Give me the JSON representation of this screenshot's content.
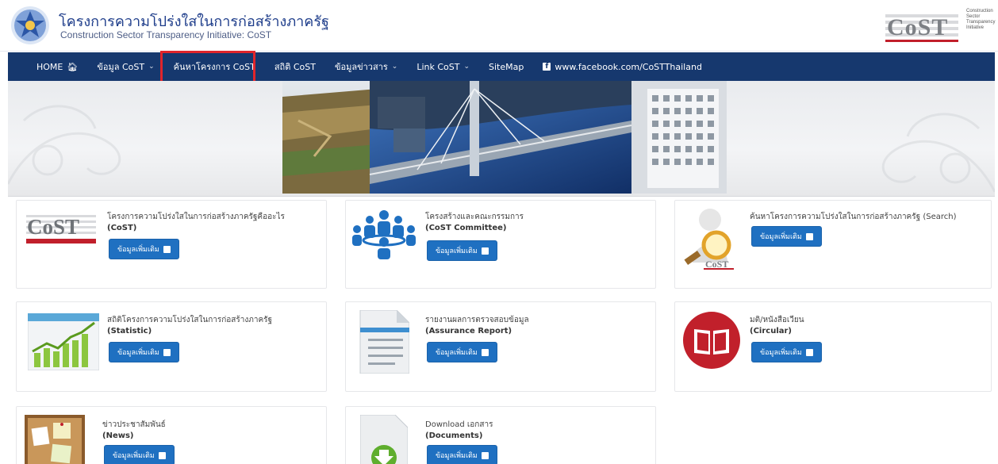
{
  "header": {
    "title": "โครงการความโปร่งใสในการก่อสร้างภาครัฐ",
    "subtitle": "Construction Sector Transparency Initiative: CoST",
    "logo_text": "CoST",
    "logo_caption": [
      "Construction",
      "Sector",
      "Transparency",
      "Initiative"
    ]
  },
  "nav": {
    "items": [
      {
        "label": "HOME",
        "icon": "home-icon",
        "caret": false
      },
      {
        "label": "ข้อมูล CoST",
        "caret": true
      },
      {
        "label": "ค้นหาโครงการ CoST",
        "caret": false
      },
      {
        "label": "สถิติ CoST",
        "caret": false
      },
      {
        "label": "ข้อมูลข่าวสาร",
        "caret": true
      },
      {
        "label": "Link CoST",
        "caret": true
      },
      {
        "label": "SiteMap",
        "caret": false
      },
      {
        "label": "www.facebook.com/CoSTThailand",
        "icon": "facebook-icon",
        "caret": false
      }
    ],
    "caret_glyph": "⌄"
  },
  "colors": {
    "nav_bg": "#16386e",
    "button_bg": "#1f70c1",
    "highlight": "#e0252b"
  },
  "cards": [
    {
      "line1": "โครงการความโปร่งใสในการก่อสร้างภาครัฐคืออะไร",
      "line2": "(CoST)",
      "button": "ข้อมูลเพิ่มเติม",
      "icon": "cost-thailand-logo-icon"
    },
    {
      "line1": "โครงสร้างและคณะกรรมการ",
      "line2": "(CoST Committee)",
      "button": "ข้อมูลเพิ่มเติม",
      "icon": "committee-people-icon"
    },
    {
      "line1": "ค้นหาโครงการความโปร่งใสในการก่อสร้างภาครัฐ (Search)",
      "line2": "",
      "button": "ข้อมูลเพิ่มเติม",
      "icon": "magnifier-person-icon"
    },
    {
      "line1": "สถิติโครงการความโปร่งใสในการก่อสร้างภาครัฐ",
      "line2": "(Statistic)",
      "button": "ข้อมูลเพิ่มเติม",
      "icon": "statistic-chart-icon"
    },
    {
      "line1": "รายงานผลการตรวจสอบข้อมูล",
      "line2": "(Assurance Report)",
      "button": "ข้อมูลเพิ่มเติม",
      "icon": "report-document-icon"
    },
    {
      "line1": "มติ/หนังสือเวียน",
      "line2": "(Circular)",
      "button": "ข้อมูลเพิ่มเติม",
      "icon": "book-circle-icon"
    },
    {
      "line1": "ข่าวประชาสัมพันธ์",
      "line2": "(News)",
      "button": "ข้อมูลเพิ่มเติม",
      "icon": "corkboard-news-icon"
    },
    {
      "line1": "Download เอกสาร",
      "line2": "(Documents)",
      "button": "ข้อมูลเพิ่มเติม",
      "icon": "download-document-icon"
    }
  ]
}
